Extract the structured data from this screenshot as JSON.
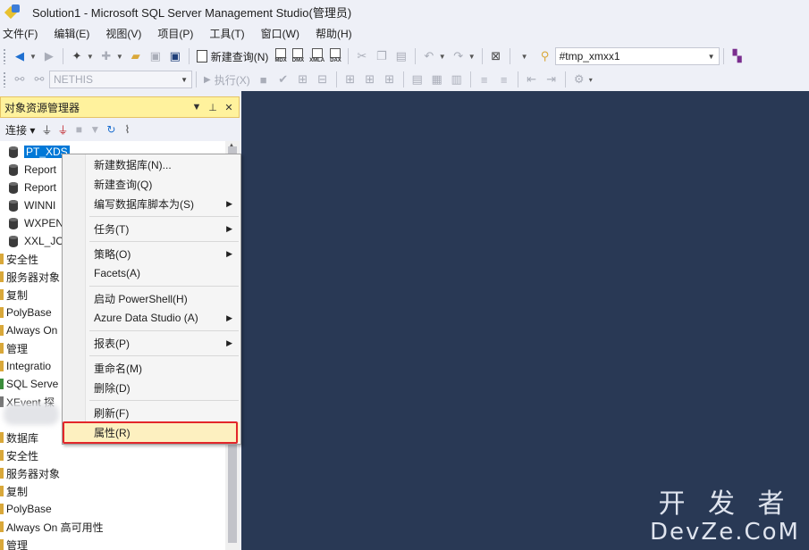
{
  "window": {
    "title": "Solution1 - Microsoft SQL Server Management Studio(管理员)"
  },
  "menu": [
    "文件(F)",
    "编辑(E)",
    "视图(V)",
    "项目(P)",
    "工具(T)",
    "窗口(W)",
    "帮助(H)"
  ],
  "toolbar": {
    "new_query_label": "新建查询(N)",
    "query_types": [
      "MDX",
      "DMX",
      "XMLA",
      "DAX"
    ],
    "database_value": "#tmp_xmxx1",
    "server_combo_value": "NETHIS",
    "execute_label": "执行(X)"
  },
  "object_explorer": {
    "title": "对象资源管理器",
    "connect_label": "连接",
    "nodes": [
      {
        "label": "PT_XDS",
        "type": "database",
        "selected": true
      },
      {
        "label": "Report",
        "type": "database"
      },
      {
        "label": "Report",
        "type": "database"
      },
      {
        "label": "WINNI",
        "type": "database"
      },
      {
        "label": "WXPEN",
        "type": "database"
      },
      {
        "label": "XXL_JO",
        "type": "database"
      },
      {
        "label": "安全性",
        "type": "folder"
      },
      {
        "label": "服务器对象",
        "type": "folder"
      },
      {
        "label": "复制",
        "type": "folder"
      },
      {
        "label": "PolyBase",
        "type": "folder"
      },
      {
        "label": "Always On",
        "type": "folder"
      },
      {
        "label": "管理",
        "type": "folder"
      },
      {
        "label": "Integratio",
        "type": "folder"
      },
      {
        "label": "SQL Serve",
        "type": "folder"
      },
      {
        "label": "XEvent 探",
        "type": "folder"
      },
      {
        "label": "数据库",
        "type": "folder"
      },
      {
        "label": "安全性",
        "type": "folder"
      },
      {
        "label": "服务器对象",
        "type": "folder"
      },
      {
        "label": "复制",
        "type": "folder"
      },
      {
        "label": "PolyBase",
        "type": "folder"
      },
      {
        "label": "Always On 高可用性",
        "type": "folder"
      },
      {
        "label": "管理",
        "type": "folder"
      }
    ]
  },
  "context_menu": {
    "items": [
      {
        "label": "新建数据库(N)...",
        "submenu": false
      },
      {
        "label": "新建查询(Q)",
        "submenu": false
      },
      {
        "label": "编写数据库脚本为(S)",
        "submenu": true
      },
      {
        "label": "任务(T)",
        "submenu": true
      },
      {
        "label": "策略(O)",
        "submenu": true
      },
      {
        "label": "Facets(A)",
        "submenu": false
      },
      {
        "label": "启动 PowerShell(H)",
        "submenu": false
      },
      {
        "label": "Azure Data Studio (A)",
        "submenu": true
      },
      {
        "label": "报表(P)",
        "submenu": true
      },
      {
        "label": "重命名(M)",
        "submenu": false
      },
      {
        "label": "删除(D)",
        "submenu": false
      },
      {
        "label": "刷新(F)",
        "submenu": false
      },
      {
        "label": "属性(R)",
        "submenu": false,
        "highlighted": true
      }
    ]
  },
  "watermark": {
    "line1": "开 发 者",
    "line2": "DevZe.CoM"
  },
  "colors": {
    "document_bg": "#293955",
    "panel_header": "#fff29d",
    "selection": "#0078d7",
    "highlight_border": "#e3262a"
  }
}
